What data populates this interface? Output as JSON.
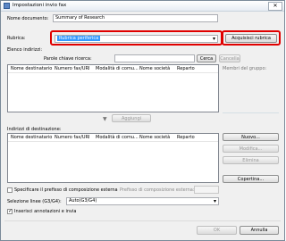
{
  "window": {
    "title": "Impostazioni invio fax",
    "close_glyph": "✕"
  },
  "name": {
    "label": "Nome documento:",
    "value": "Summary of Research"
  },
  "rubrica": {
    "label": "Rubrica:",
    "value": "Rubrica periferica",
    "acquire_button": "Acquisisci rubrica"
  },
  "elenco": {
    "label": "Elenco indirizzi:",
    "search_label": "Parole chiave ricerca:",
    "search_value": "",
    "search_button": "Cerca",
    "cancel_button": "Cancella",
    "columns": [
      "Nome destinatario",
      "Numero fax/URI",
      "Modalità di comu...",
      "Nome società",
      "Reparto"
    ]
  },
  "group_members_label": "Membri del gruppo:",
  "add_button": "Aggiungi",
  "destinazione": {
    "label": "Indirizzi di destinazione:",
    "columns": [
      "Nome destinatario",
      "Numero fax/URI",
      "Modalità di comu...",
      "Nome società",
      "Reparto"
    ],
    "buttons": {
      "nuovo": "Nuovo...",
      "modifica": "Modifica...",
      "elimina": "Elimina",
      "copertina": "Copertina..."
    }
  },
  "prefix": {
    "checkbox_label": "Specificare il prefisso di composizione esterna",
    "checked": false,
    "field_label": "Prefisso di composizione esterna:",
    "field_value": ""
  },
  "line": {
    "label": "Selezione linee (G3/G4):",
    "value": "Auto(G3/G4)"
  },
  "annotations": {
    "label": "Inserisci annotazioni e invia",
    "checked": true
  },
  "footer": {
    "ok": "OK",
    "cancel": "Annulla"
  },
  "colors": {
    "highlight": "#e00000",
    "selected_row": "#3399ff"
  }
}
